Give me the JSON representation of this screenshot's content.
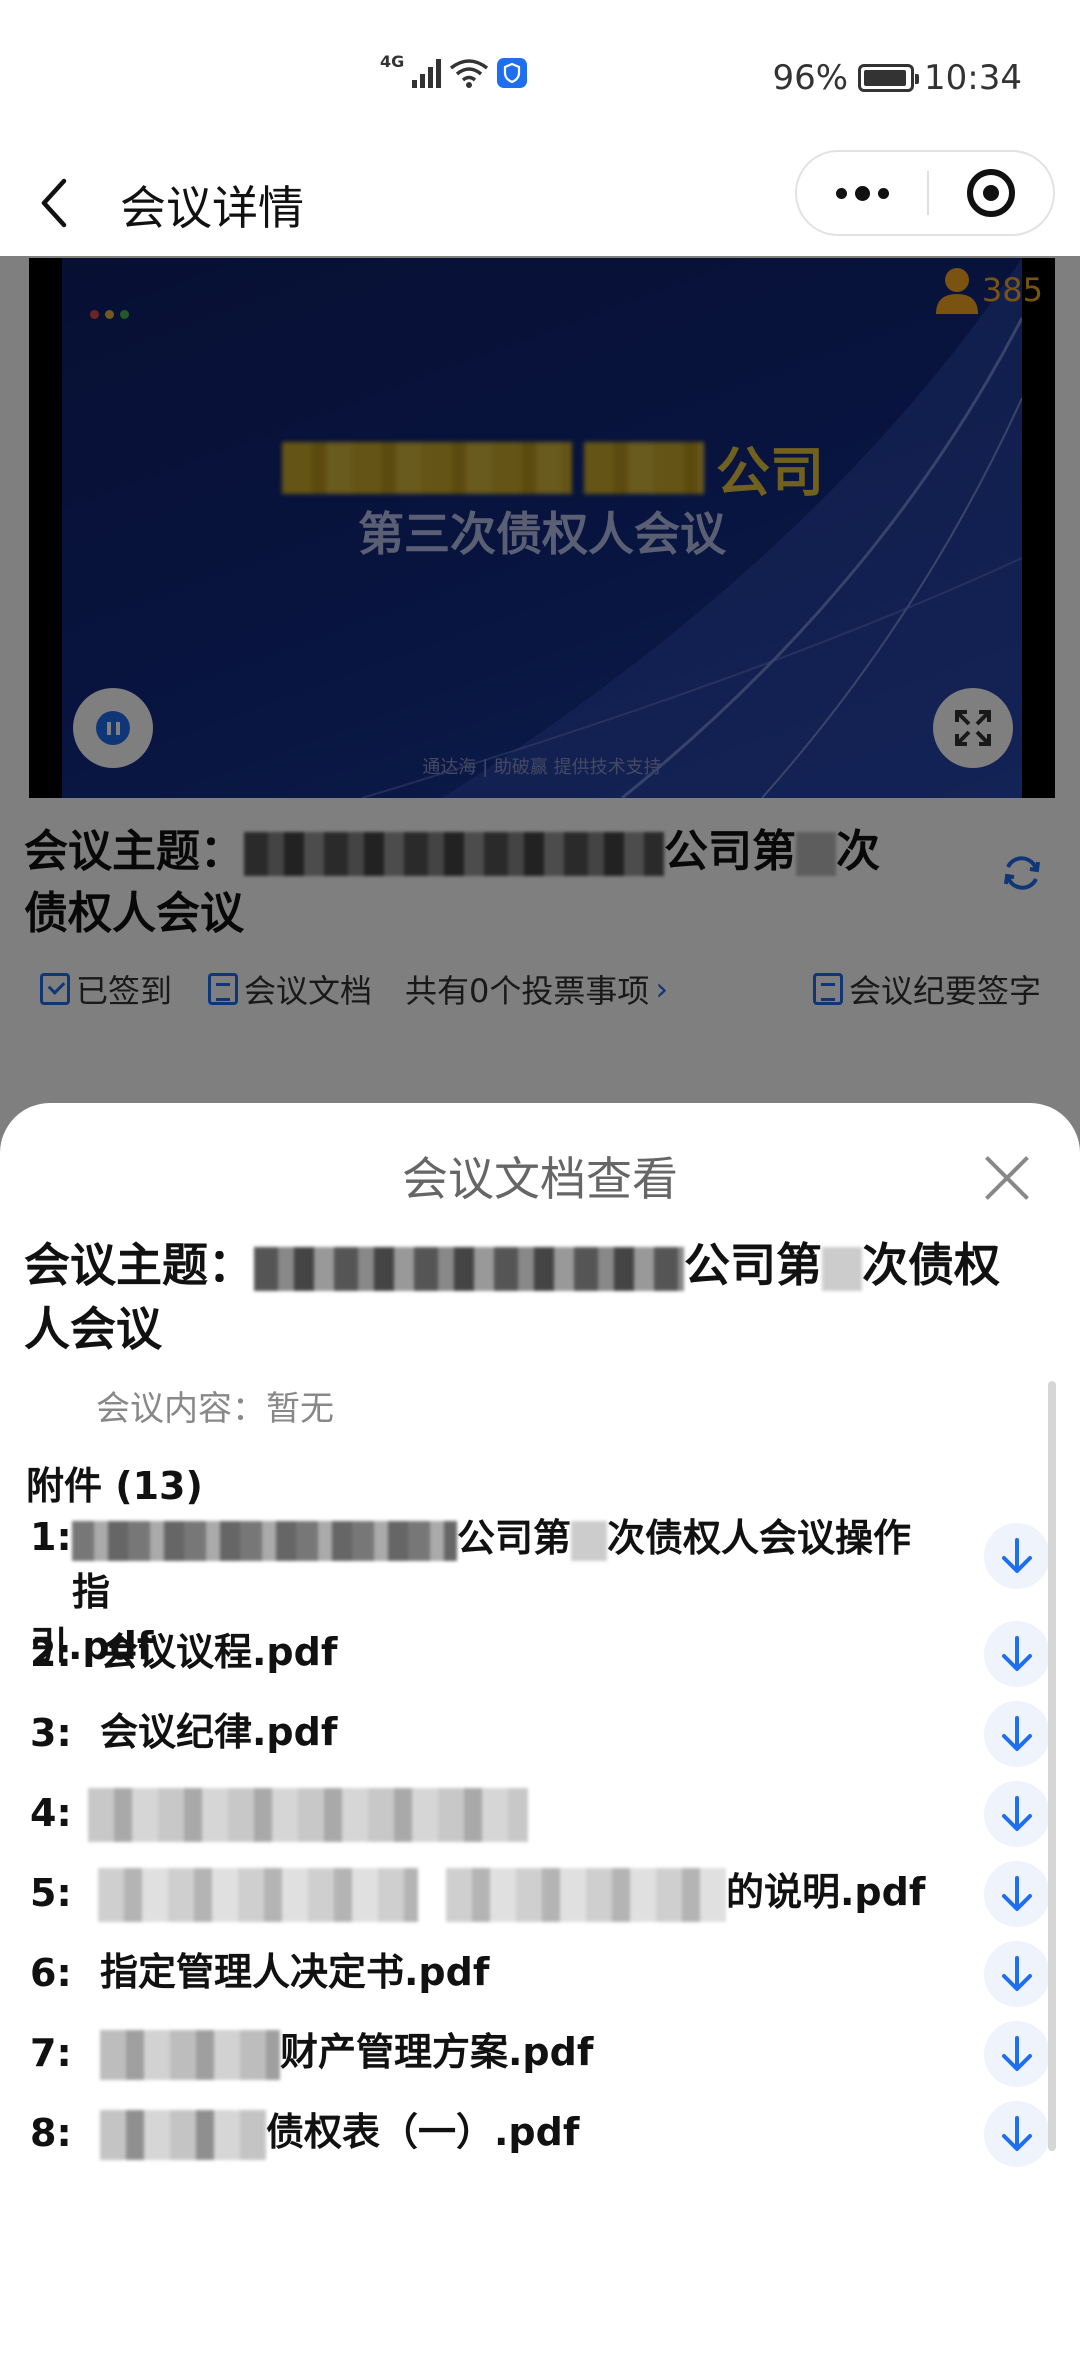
{
  "status_bar": {
    "network": "4G",
    "battery_percent_text": "96%",
    "battery_level": 0.96,
    "time": "10:34"
  },
  "nav": {
    "title": "会议详情",
    "back_icon": "chevron-left-icon",
    "more_icon": "more-dots-icon",
    "target_icon": "target-circle-icon"
  },
  "video": {
    "slide_company_suffix": "公司",
    "slide_subtitle": "第三次债权人会议",
    "slide_footer": "通达海 | 助破赢 提供技术支持",
    "viewer_count": "385"
  },
  "meeting": {
    "topic_label": "会议主题：",
    "topic_mid": "公司第",
    "topic_end": "次",
    "topic_line2": "债权人会议"
  },
  "tabs": {
    "signed_in": "已签到",
    "documents": "会议文档",
    "vote_items": "共有0个投票事项",
    "minutes_sign": "会议纪要签字"
  },
  "sheet": {
    "title": "会议文档查看",
    "topic_label": "会议主题：",
    "topic_mid": "公司第",
    "topic_end": "次债权",
    "topic_line2": "人会议",
    "content_text": "会议内容：暂无",
    "attachments_header": "附件 (13)",
    "files": [
      {
        "num": "1:",
        "prefix_blurred": true,
        "text_mid": "公司第",
        "text_end": "次债权人会议操作指",
        "text_line2": "引.pdf"
      },
      {
        "num": "2:",
        "text": "会议议程.pdf"
      },
      {
        "num": "3:",
        "text": "会议纪律.pdf"
      },
      {
        "num": "4:",
        "text": ""
      },
      {
        "num": "5:",
        "text": "的说明.pdf"
      },
      {
        "num": "6:",
        "text": "指定管理人决定书.pdf"
      },
      {
        "num": "7:",
        "text": "财产管理方案.pdf"
      },
      {
        "num": "8:",
        "text": "债权表（一）.pdf"
      }
    ]
  },
  "colors": {
    "accent": "#1e6ff0",
    "overlay": "rgba(0,0,0,0.5)",
    "viewer_badge": "#f5a623"
  }
}
